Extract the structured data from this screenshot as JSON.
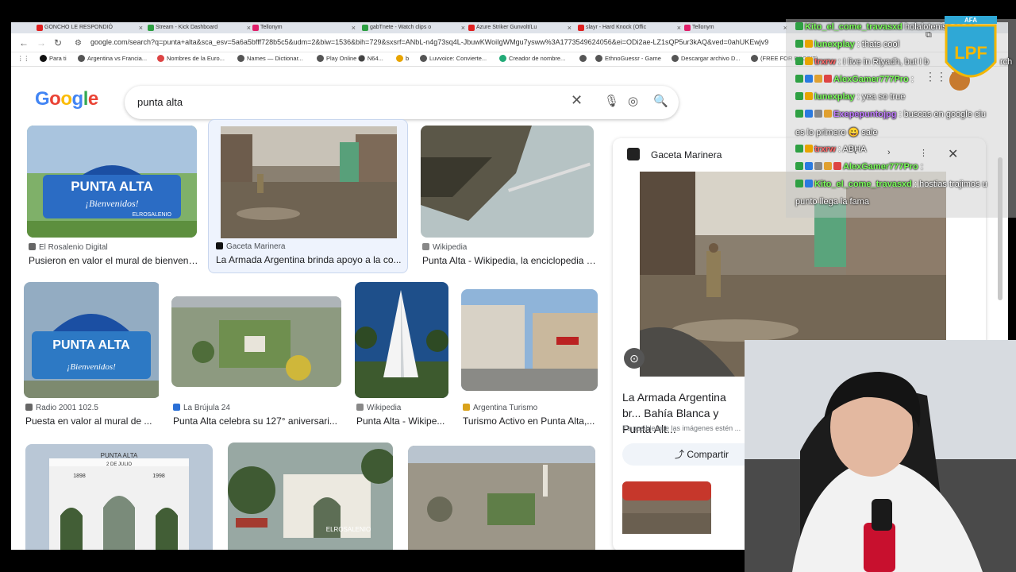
{
  "tabs": [
    {
      "label": "GONCHO LE RESPONDIÓ",
      "color": "#e02020"
    },
    {
      "label": "Stream - Kick Dashboard",
      "color": "#2ea043"
    },
    {
      "label": "Tellonym",
      "color": "#e0206a"
    },
    {
      "label": "gabTnete - Watch clips o",
      "color": "#2ea043"
    },
    {
      "label": "Azure Striker Gunvolt/Lu",
      "color": "#e02020"
    },
    {
      "label": "slayr - Hard Knock (Offic",
      "color": "#e02020"
    },
    {
      "label": "Tellonym",
      "color": "#e0206a"
    }
  ],
  "url": "google.com/search?q=punta+alta&sca_esv=5a6a5bfff728b5c5&udm=2&biw=1536&bih=729&sxsrf=ANbL-n4g73sq4L-JbuwKWoiIgWMgu7ysww%3A1773549624056&ei=ODi2ae-LZ1sQP5ur3kAQ&ved=0ahUKEwjv9",
  "bookmarks": [
    "Para ti",
    "Argentina vs Francia...",
    "Nombres de la Euro...",
    "Names — Dictionar...",
    "Play Online ⚫ N64...",
    "b",
    "Luvvoice: Convierte...",
    "Creador de nombre...",
    "",
    "EthnoGuessr - Game",
    "Descargar archivo D...",
    "(FREE FOR PROFIT)..."
  ],
  "search": {
    "logo": "Google",
    "query": "punta alta"
  },
  "results": [
    {
      "source": "El Rosalenio Digital",
      "title": "Pusieron en valor el mural de bienveni..."
    },
    {
      "source": "Gaceta Marinera",
      "title": "La Armada Argentina brinda apoyo a la co..."
    },
    {
      "source": "Wikipedia",
      "title": "Punta Alta - Wikipedia, la enciclopedia li..."
    },
    {
      "source": "Radio 2001 102.5",
      "title": "Puesta en valor al mural de ..."
    },
    {
      "source": "La Brújula 24",
      "title": "Punta Alta celebra su 127° aniversari..."
    },
    {
      "source": "Wikipedia",
      "title": "Punta Alta - Wikipe..."
    },
    {
      "source": "Argentina Turismo",
      "title": "Turismo Activo en Punta Alta,..."
    }
  ],
  "image_text": {
    "sign": "PUNTA ALTA",
    "sign_sub": "¡Bienvenidos!",
    "watermark": "ELROSALENIO",
    "arch": "PUNTA ALTA",
    "arch_date": "2 DE JULIO",
    "y1": "1898",
    "y2": "1998"
  },
  "panel": {
    "source": "Gaceta Marinera",
    "title": "La Armada Argentina br... Bahía Blanca y Punta Alt...",
    "note": "Es posible que las imágenes estén ...",
    "share": "Compartir"
  },
  "chat": [
    {
      "user": "Kito_el_come_travasxd",
      "text": "holaloteniso se pe",
      "color": "#7bff5a"
    },
    {
      "user": "lunexplay",
      "text": ": thats cool",
      "color": "#7bff5a"
    },
    {
      "user": "trxrw",
      "text": ": I live in Riyadh, but I b",
      "color": "#ff6a6a"
    },
    {
      "user": "AlexGamer777Pro",
      "text": ":",
      "color": "#7bff5a"
    },
    {
      "user": "lunexplay",
      "text": ": yea so true",
      "color": "#7bff5a"
    },
    {
      "user": "Exepepuntojpg",
      "text": ": buscas en google ciu",
      "color": "#c07bff"
    },
    {
      "user": "",
      "text": "es lo primero 😀 sale",
      "color": "#ffffff"
    },
    {
      "user": "trxrw",
      "text": ": ABHA",
      "color": "#ff6a6a"
    },
    {
      "user": "AlexGamer777Pro",
      "text": ":",
      "color": "#7bff5a"
    },
    {
      "user": "Kito_el_come_travasxd",
      "text": ": hostias trajimos u",
      "color": "#7bff5a"
    },
    {
      "user": "",
      "text": "punto llega la fama",
      "color": "#ffffff"
    }
  ],
  "chat_extra": {
    "rch": "rch"
  },
  "lpf": {
    "top": "AFA",
    "logo": "LPF"
  },
  "colors": {
    "accent": "#1a73e8",
    "lpf_blue": "#2fa8d6",
    "lpf_gold": "#f2b705"
  }
}
